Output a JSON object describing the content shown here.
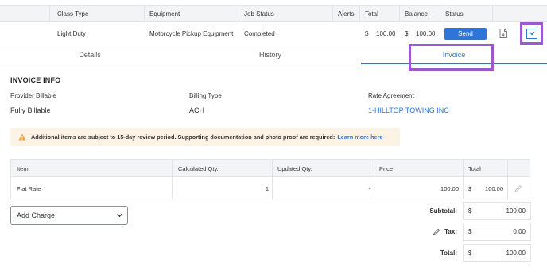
{
  "job_table": {
    "headers": {
      "class_type": "Class Type",
      "equipment": "Equipment",
      "job_status": "Job Status",
      "alerts": "Alerts",
      "total": "Total",
      "balance": "Balance",
      "status": "Status"
    },
    "row": {
      "class_type": "Light Duty",
      "equipment": "Motorcycle Pickup Equipment",
      "job_status": "Completed",
      "total_currency": "$",
      "total_amount": "100.00",
      "balance_currency": "$",
      "balance_amount": "100.00",
      "send_label": "Send"
    }
  },
  "tabs": [
    {
      "label": "Details",
      "active": false
    },
    {
      "label": "History",
      "active": false
    },
    {
      "label": "Invoice",
      "active": true
    }
  ],
  "invoice_info": {
    "heading": "INVOICE INFO",
    "provider_billable_label": "Provider Billable",
    "provider_billable_value": "Fully Billable",
    "billing_type_label": "Billing Type",
    "billing_type_value": "ACH",
    "rate_agreement_label": "Rate Agreement",
    "rate_agreement_value": "1-HILLTOP TOWING INC"
  },
  "notice": {
    "text": "Additional items are subject to 15-day review period. Supporting documentation and photo proof are required:",
    "link": "Learn more here"
  },
  "items_table": {
    "headers": {
      "item": "Item",
      "calculated_qty": "Calculated Qty.",
      "updated_qty": "Updated Qty.",
      "price": "Price",
      "total": "Total"
    },
    "rows": [
      {
        "item": "Flat Rate",
        "calculated_qty": "1",
        "updated_qty": "-",
        "price": "100.00",
        "total_currency": "$",
        "total_amount": "100.00"
      }
    ]
  },
  "add_charge": {
    "selected": "Add Charge"
  },
  "totals": {
    "subtotal_label": "Subtotal:",
    "subtotal_currency": "$",
    "subtotal_amount": "100.00",
    "tax_label": "Tax:",
    "tax_currency": "$",
    "tax_amount": "0.00",
    "total_label": "Total:",
    "total_currency": "$",
    "total_amount": "100.00"
  },
  "colors": {
    "accent": "#2f74d8",
    "highlight": "#9b59d0",
    "notice_bg": "#fdf3e4",
    "warning": "#f0a33a"
  },
  "icons": [
    "document-icon",
    "chevron-down-icon",
    "warning-icon",
    "pencil-icon",
    "caret-down-icon"
  ]
}
